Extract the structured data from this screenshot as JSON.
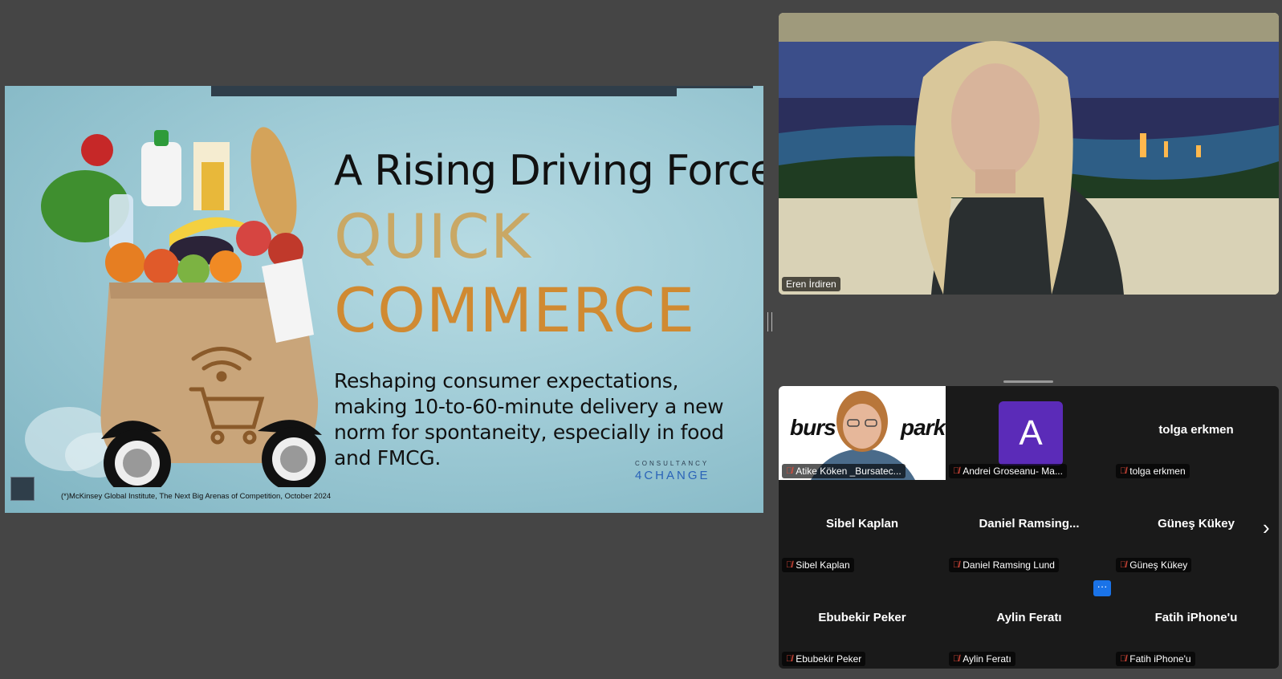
{
  "slide": {
    "title": "A Rising Driving Force:",
    "highlight_line1": "QUICK",
    "highlight_line2": "COMMERCE",
    "body": "Reshaping consumer expectations, making 10-to-60-minute delivery a new norm for spontaneity, especially in food and FMCG.",
    "brand_small": "CONSULTANCY",
    "brand_big": "4CHANGE",
    "footnote": "(*)McKinsey Global Institute, The Next Big Arenas of Competition, October 2024"
  },
  "speaker": {
    "name": "Eren İrdiren"
  },
  "gallery": {
    "logo_left": "burs",
    "logo_right": "park",
    "avatar_letter": "A",
    "participants": [
      {
        "display": "",
        "label": "Atike Köken _Bursatec..."
      },
      {
        "display": "",
        "label": "Andrei Groseanu- Ma..."
      },
      {
        "display": "tolga erkmen",
        "label": "tolga erkmen"
      },
      {
        "display": "Sibel Kaplan",
        "label": "Sibel Kaplan"
      },
      {
        "display": "Daniel  Ramsing...",
        "label": "Daniel Ramsing Lund"
      },
      {
        "display": "Güneş Kükey",
        "label": "Güneş Kükey"
      },
      {
        "display": "Ebubekir Peker",
        "label": "Ebubekir Peker"
      },
      {
        "display": "Aylin Feratı",
        "label": "Aylin Feratı"
      },
      {
        "display": "Fatih iPhone'u",
        "label": "Fatih iPhone'u"
      }
    ],
    "more_label": "···",
    "next_label": "›"
  },
  "colors": {
    "highlight_gold": "#c9a865",
    "highlight_orange": "#d08a32",
    "muted_mic": "#e74c3c",
    "avatar_purple": "#5b2bb8",
    "more_blue": "#1a73e8"
  }
}
